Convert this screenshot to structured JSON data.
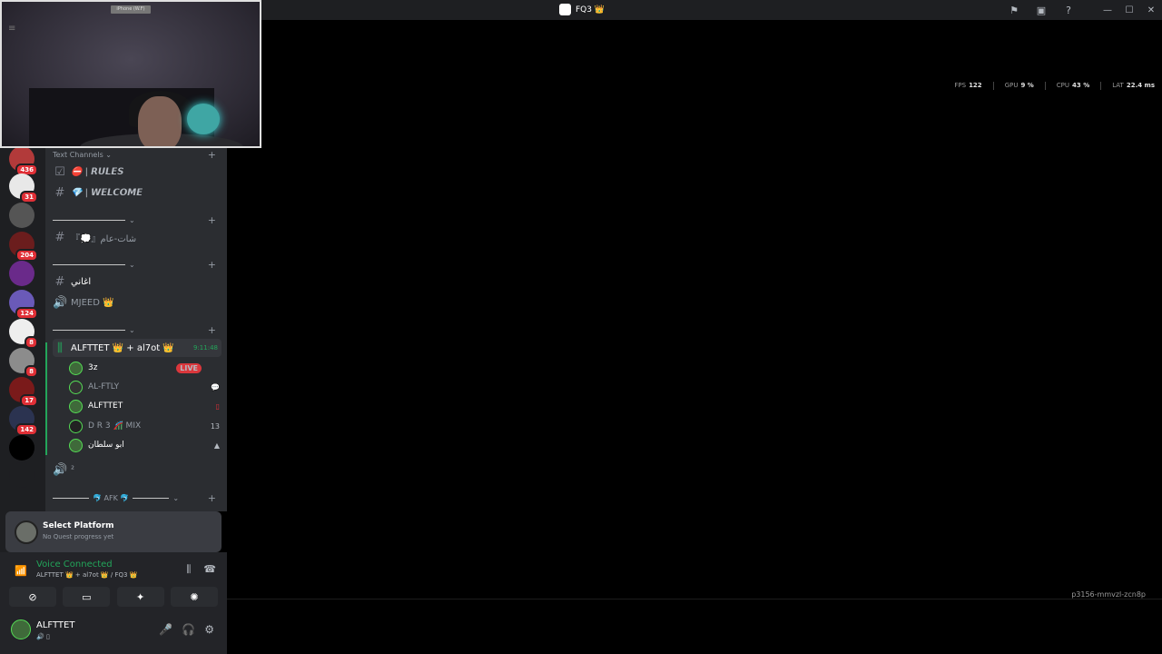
{
  "titlebar": {
    "title": "FQ3 👑"
  },
  "camera": {
    "label": "iPhone (W.F)"
  },
  "stats": [
    {
      "label": "FPS",
      "value": "122"
    },
    {
      "label": "GPU",
      "value": "9 %"
    },
    {
      "label": "CPU",
      "value": "43 %"
    },
    {
      "label": "LAT",
      "value": "22.4 ms"
    }
  ],
  "stream_id": "p3156-mmvzl-zcn8p",
  "servers": {
    "badges": [
      "436",
      "31",
      "204",
      "124",
      "8",
      "8",
      "17",
      "142"
    ]
  },
  "channels": {
    "text_category": "Text Channels ⌄",
    "rules": "⛔ | 𝙍𝙐𝙇𝙀𝙎",
    "welcome": "💎 | 𝙒𝙀𝙇𝘾𝙊𝙈𝙀",
    "chat": "『💭』شات-عام",
    "songs": "اغاني",
    "mjeed": "MJEED 👑",
    "voice_channel": "ALFTTET 👑 + al7ot 👑",
    "voice_timer": "9:11:48",
    "members": [
      {
        "name": "3z",
        "right": "LIVE"
      },
      {
        "name": "AL-FTLY",
        "right": "💬"
      },
      {
        "name": "ALFTTET",
        "right": "▯"
      },
      {
        "name": "D R 3 🎢 MIX",
        "right": "13"
      },
      {
        "name": "ابو سلطان",
        "right": "▲"
      }
    ],
    "speaker_channel": "²",
    "afk_category": "🐬 AFK 🐬"
  },
  "quest": {
    "title": "Select Platform",
    "subtitle": "No Quest progress yet"
  },
  "voice": {
    "title": "Voice Connected",
    "subtitle": "ALFTTET 👑 + al7ot 👑 / FQ3 👑"
  },
  "user": {
    "name": "ALFTTET",
    "status": "🔊 ▯"
  }
}
